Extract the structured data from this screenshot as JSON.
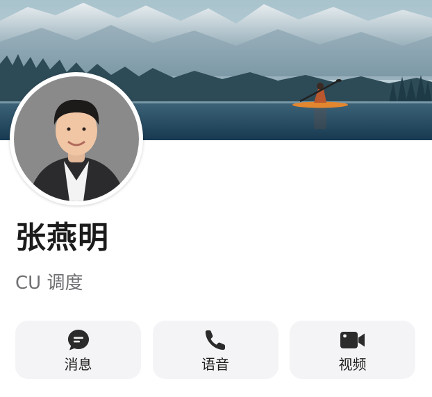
{
  "profile": {
    "name": "张燕明",
    "subtitle": "CU 调度"
  },
  "actions": [
    {
      "label": "消息",
      "icon": "message-icon"
    },
    {
      "label": "语音",
      "icon": "phone-icon"
    },
    {
      "label": "视频",
      "icon": "video-camera-icon"
    }
  ],
  "colors": {
    "button_bg": "#f4f4f6",
    "icon": "#2b2b2b",
    "subtitle": "#6f6f73",
    "name": "#1b1b1b"
  }
}
